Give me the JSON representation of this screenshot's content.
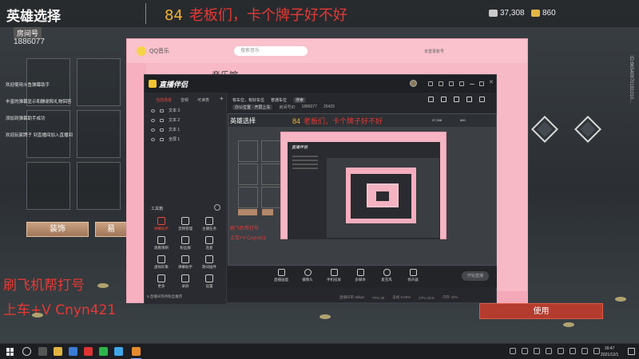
{
  "game": {
    "title": "英雄选择",
    "room_label": "房间号",
    "room_number": "1886077",
    "currency1": "37,308",
    "currency2": "860",
    "use_button": "使用",
    "decor_button": "装饰",
    "second_button": "易",
    "side_vertical_text": "ID:86540870181010...",
    "notices": [
      "欢迎使用斗鱼弹幕助手",
      "丰富的弹幕显示和酬谢和礼物回答",
      "添加到弹幕助手成功",
      "欢迎玩家牌子 到直播间加入直播间"
    ]
  },
  "stream_message": {
    "number": "84",
    "text": "老板们，卡个牌子好不好"
  },
  "overlay": {
    "line1": "刷飞机帮打号",
    "line2": "上车+V Cnyn421"
  },
  "qq_music": {
    "app_name": "QQ音乐",
    "search_placeholder": "搜索音乐",
    "nav_title": "音乐馆",
    "user": "未登录账号"
  },
  "zb_app": {
    "logo": "直播伴侣",
    "tabs": [
      "当前场景",
      "音频",
      "可读表"
    ],
    "layers": [
      {
        "label": "文本 3"
      },
      {
        "label": "文本 2"
      },
      {
        "label": "文本 1"
      },
      {
        "label": "全屏 1"
      }
    ],
    "tools_title": "工具箱",
    "tools": [
      {
        "label": "弹幕助手",
        "active": true
      },
      {
        "label": "音频管理",
        "active": false
      },
      {
        "label": "主播任务",
        "active": false
      },
      {
        "label": "观看限制",
        "active": false
      },
      {
        "label": "粉丝群",
        "active": false
      },
      {
        "label": "连麦",
        "active": false
      },
      {
        "label": "虚拟形象",
        "active": false
      },
      {
        "label": "弹幕助手",
        "active": false
      },
      {
        "label": "歌词插件",
        "active": false
      },
      {
        "label": "更多",
        "active": false
      },
      {
        "label": "录屏",
        "active": false
      },
      {
        "label": "设置",
        "active": false
      }
    ],
    "bottom_hint": "5 直播间等待粉丝推荐",
    "info_line1": [
      "有车位，有好车位",
      "普通车位",
      "搜索"
    ],
    "info_line2_label": "办公位置 · 开屏上车",
    "room_id_label": "房间号ID",
    "room_id": "1886077",
    "popularity": "26429",
    "preview": {
      "game_title": "英雄选择",
      "msg_number": "84",
      "msg_text": "老板们，卡个牌子好不好",
      "cur1": "37,308",
      "cur2": "860",
      "red1": "刷飞机帮打号",
      "red2": "上车+V Cnyn421"
    },
    "dock": [
      {
        "label": "直播画面"
      },
      {
        "label": "摄像头"
      },
      {
        "label": "手机投屏"
      },
      {
        "label": "多媒体"
      },
      {
        "label": "麦克风"
      },
      {
        "label": "扬声器"
      }
    ],
    "start_live": "开始直播",
    "status": [
      "直播码率 0kbps",
      "FPS 30",
      "丢帧 0.00%",
      "CPU 31%",
      "内存 42%"
    ]
  },
  "taskbar": {
    "time": "16:47",
    "date": "2021/12/1"
  }
}
